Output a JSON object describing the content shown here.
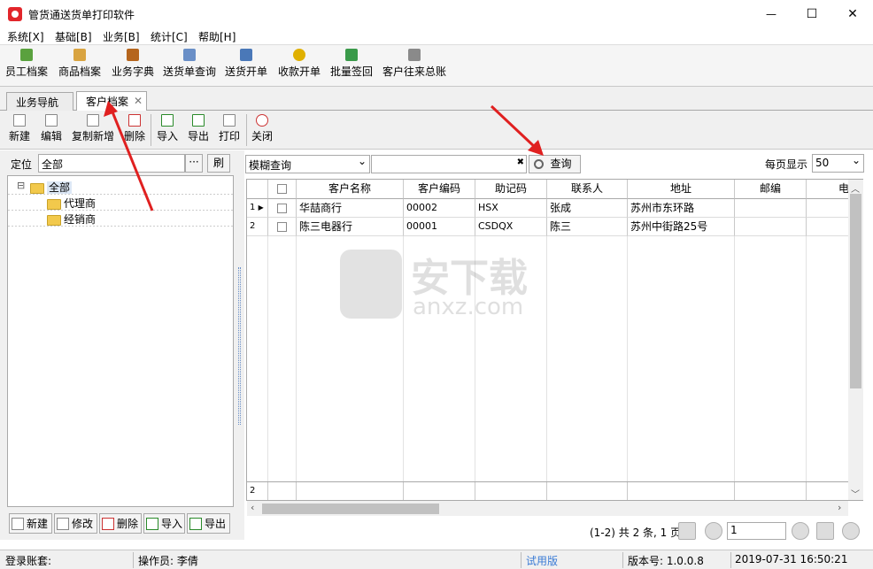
{
  "window": {
    "title": "管货通送货单打印软件",
    "minimize": "—",
    "maximize": "☐",
    "close": "✕"
  },
  "menu": [
    "系统[X]",
    "基础[B]",
    "业务[B]",
    "统计[C]",
    "帮助[H]"
  ],
  "toolbar": [
    {
      "label": "员工档案",
      "icon": "employee-icon",
      "color": "#5aa13e"
    },
    {
      "label": "商品档案",
      "icon": "product-icon",
      "color": "#d9a441"
    },
    {
      "label": "业务字典",
      "icon": "book-icon",
      "color": "#b5651d"
    },
    {
      "label": "送货单查询",
      "icon": "calendar-icon",
      "color": "#6a8fc7"
    },
    {
      "label": "送货开单",
      "icon": "document-icon",
      "color": "#4a78b8"
    },
    {
      "label": "收款开单",
      "icon": "coins-icon",
      "color": "#e0b000"
    },
    {
      "label": "批量签回",
      "icon": "truck-icon",
      "color": "#3a9a4a"
    },
    {
      "label": "客户往来总账",
      "icon": "ledger-icon",
      "color": "#8a8a8a"
    }
  ],
  "tabs": {
    "nav": "业务导航",
    "customer": "客户档案",
    "close": "✕"
  },
  "subtoolbar": [
    "新建",
    "编辑",
    "复制新增",
    "删除",
    "导入",
    "导出",
    "打印",
    "关闭"
  ],
  "left": {
    "locate_label": "定位",
    "locate_value": "全部",
    "ellipsis": "···",
    "refresh": "刷",
    "tree": {
      "expander": "⊟",
      "root": "全部",
      "children": [
        "代理商",
        "经销商"
      ]
    },
    "buttons": [
      "新建",
      "修改",
      "删除",
      "导入",
      "导出"
    ]
  },
  "search": {
    "mode": "模糊查询",
    "dropdown": "⌄",
    "clear": "✖",
    "query": "查询",
    "per_page_label": "每页显示",
    "per_page": "50"
  },
  "grid": {
    "columns": [
      "客户名称",
      "客户编码",
      "助记码",
      "联系人",
      "地址",
      "邮编",
      "电"
    ],
    "rows": [
      {
        "num": "1",
        "arrow": "▶",
        "name": "华喆商行",
        "code": "00002",
        "mnemonic": "HSX",
        "contact": "张成",
        "address": "苏州市东环路",
        "zip": ""
      },
      {
        "num": "2",
        "arrow": "",
        "name": "陈三电器行",
        "code": "00001",
        "mnemonic": "CSDQX",
        "contact": "陈三",
        "address": "苏州中街路25号",
        "zip": ""
      }
    ],
    "footer_count": "2"
  },
  "pager": {
    "summary": "(1-2) 共 2 条, 1 页",
    "page": "1"
  },
  "status": {
    "account": "登录账套:",
    "operator": "操作员: 李倩",
    "trial": "试用版",
    "version": "版本号: 1.0.0.8",
    "datetime": "2019-07-31   16:50:21"
  },
  "watermark": {
    "text": "安下载",
    "url": "anxz.com"
  },
  "colors": {
    "accent": "#e02020",
    "trial": "#3a7bd5"
  }
}
